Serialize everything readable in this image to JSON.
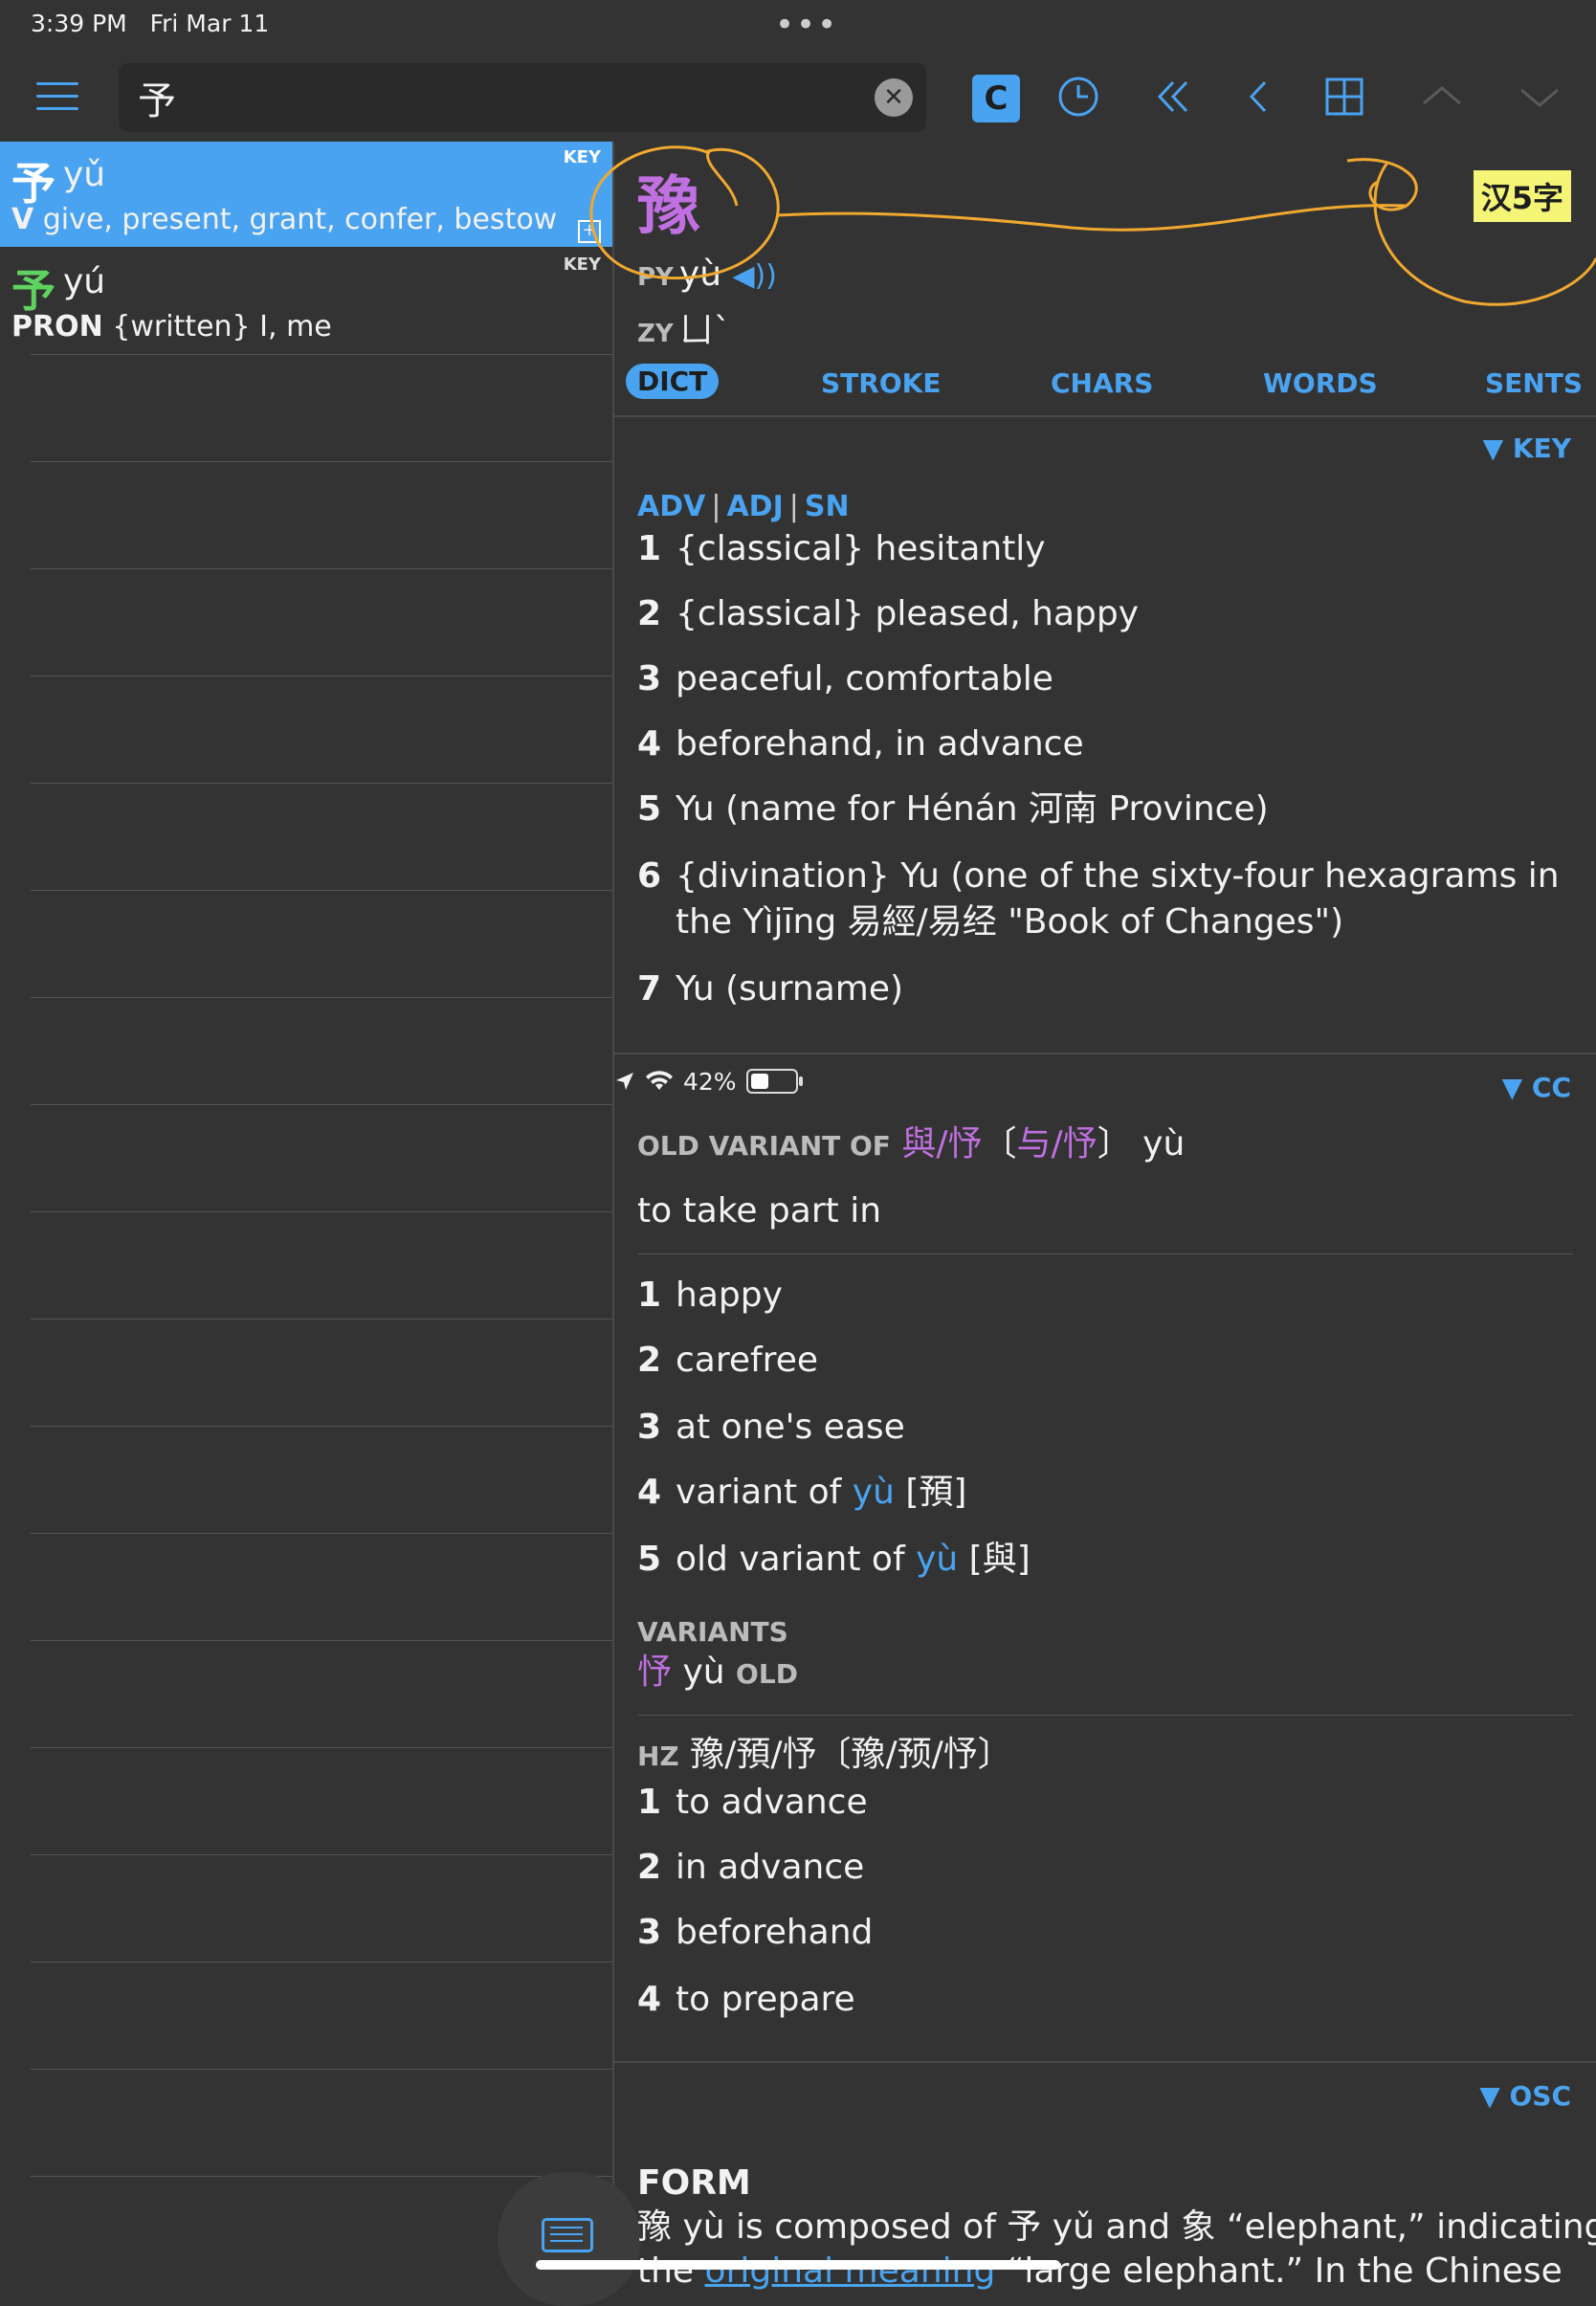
{
  "status_bar": {
    "time": "3:39 PM",
    "date": "Fri Mar 11",
    "battery": "42%",
    "battery_level": 0.42
  },
  "toolbar": {
    "search_value": "予",
    "clear_icon": "clear-icon",
    "c_label": "C"
  },
  "results": [
    {
      "hz": "予",
      "py": "yǔ",
      "pos": "V",
      "def": "give, present, grant, confer, bestow",
      "tag": "KEY",
      "selected": true
    },
    {
      "hz": "予",
      "py": "yú",
      "pos": "PRON",
      "def": "{written} I, me",
      "tag": "KEY",
      "selected": false
    }
  ],
  "detail": {
    "headword": "豫",
    "hsk": "汉5字",
    "py_label": "PY",
    "pinyin": "yù",
    "zy_label": "ZY",
    "zhuyin": "ㄩˋ",
    "tabs": [
      "DICT",
      "STROKE",
      "CHARS",
      "WORDS",
      "SENTS"
    ],
    "key_section": {
      "tag": "▼ KEY",
      "pos": [
        "ADV",
        "ADJ",
        "SN"
      ],
      "defs": [
        "{classical} hesitantly",
        "{classical} pleased, happy",
        "peaceful, comfortable",
        "beforehand, in advance",
        "Yu (name for Hénán 河南 Province)",
        "{divination} Yu (one of the sixty-four hexagrams in the Yìjīng 易經/易经 \"Book of Changes\")",
        "Yu (surname)"
      ]
    },
    "cc_section": {
      "tag": "▼ CC",
      "old_variant_label": "OLD VARIANT OF",
      "old_variant_chars": "與/忬",
      "old_variant_simp": "与/忬",
      "old_variant_py": "yù",
      "old_variant_meaning": "to take part in",
      "defs": [
        "happy",
        "carefree",
        "at one's ease",
        "variant of",
        "old variant of"
      ],
      "def4_py": "yù",
      "def4_hz": "[預]",
      "def5_py": "yù",
      "def5_hz": "[與]",
      "variants_label": "VARIANTS",
      "variant_hz": "忬",
      "variant_py": "yù",
      "variant_tag": "OLD"
    },
    "hz_section": {
      "label": "HZ",
      "chars": "豫/預/忬〔豫/预/忬〕",
      "defs": [
        "to advance",
        "in advance",
        "beforehand",
        "to prepare"
      ]
    },
    "osc_section": {
      "tag": "▼ OSC",
      "form_label": "FORM",
      "form_text": "豫 yù is composed of 予 yǔ and 象 “elephant,” indicating",
      "form_text2_pre": "the",
      "form_link": "original meaning",
      "form_text2_post": "“large elephant.” In the Chinese"
    }
  }
}
